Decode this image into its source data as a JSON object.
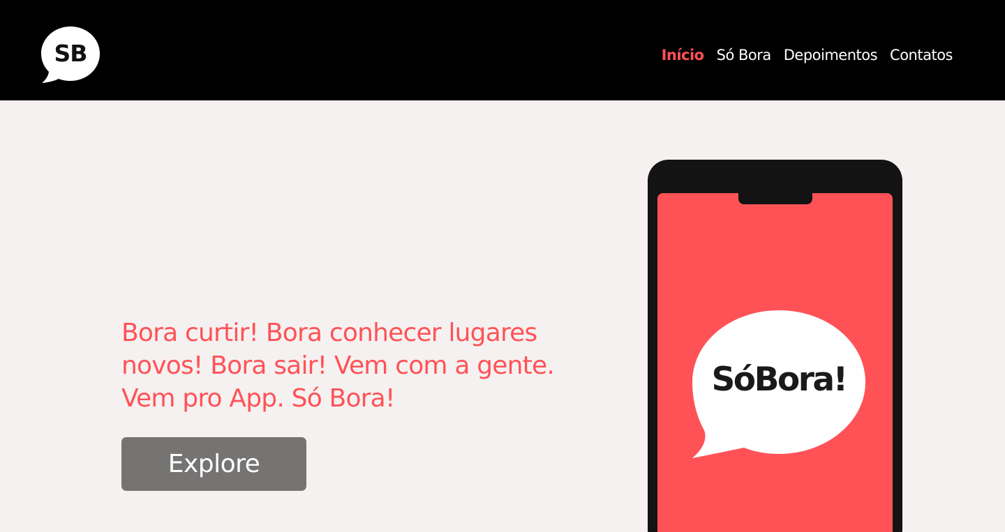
{
  "header": {
    "logo_text": "SB",
    "nav": [
      {
        "label": "Início",
        "active": true
      },
      {
        "label": "Só Bora",
        "active": false
      },
      {
        "label": "Depoimentos",
        "active": false
      },
      {
        "label": "Contatos",
        "active": false
      }
    ]
  },
  "hero": {
    "text": "Bora curtir! Bora conhecer lugares novos! Bora sair! Vem com a gente. Vem pro App. Só Bora!",
    "button_label": "Explore"
  },
  "phone": {
    "bubble_text": "SóBora!"
  },
  "colors": {
    "accent": "#ff5257",
    "header_bg": "#000000",
    "page_bg": "#f5f1f0",
    "button_bg": "#767373"
  }
}
